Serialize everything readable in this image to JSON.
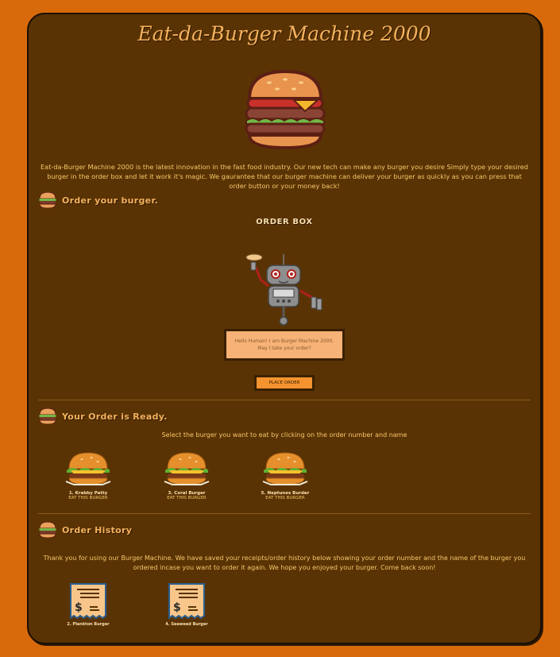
{
  "app": {
    "title": "Eat-da-Burger Machine 2000",
    "intro": "Eat-da-Burger Machine 2000 is the latest innovation in the fast food industry. Our new tech can make any burger you desire Simply type your desired burger in the order box and let it work it's magic. We gaurantee that our burger machine can deliver your burger as quickly as you can press that order button or your money back!"
  },
  "order": {
    "section_title": "Order your burger.",
    "box_title": "ORDER BOX",
    "input_placeholder": "Hello Human! I am Burger Machine 2000. May I take your order?",
    "button_label": "PLACE ORDER"
  },
  "ready": {
    "section_title": "Your Order is Ready.",
    "description": "Select the burger you want to eat by clicking on the order number and name",
    "items": [
      {
        "name": "1. Krabby Patty",
        "action": "EAT THIS BURGER"
      },
      {
        "name": "3. Coral Burger",
        "action": "EAT THIS BURGER"
      },
      {
        "name": "5. Neptunes Burder",
        "action": "EAT THIS BURGER"
      }
    ]
  },
  "history": {
    "section_title": "Order History",
    "description": "Thank you for using our Burger Machine. We have saved your receipts/order history below showing your order number and the name of the burger you ordered incase you want to order it again. We hope you enjoyed your burger. Come back soon!",
    "items": [
      {
        "name": "2. Plankton Burger"
      },
      {
        "name": "4. Seaweed Burger"
      }
    ]
  },
  "colors": {
    "background": "#d86a0c",
    "panel": "#5a3304",
    "accent": "#f4b25c",
    "button": "#f5932f"
  }
}
